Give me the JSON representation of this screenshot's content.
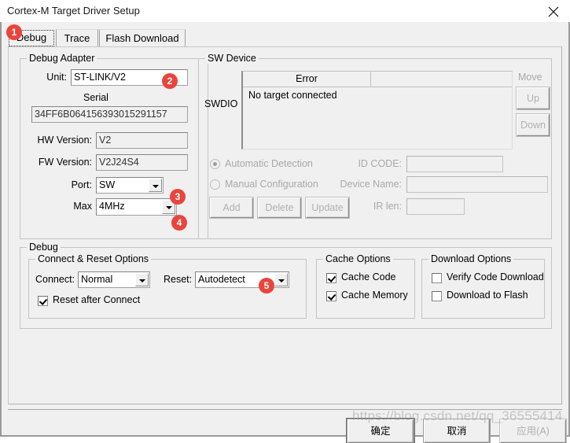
{
  "window": {
    "title": "Cortex-M Target Driver Setup",
    "close_icon": "close-icon"
  },
  "tabs": [
    {
      "label": "Debug",
      "selected": true
    },
    {
      "label": "Trace",
      "selected": false
    },
    {
      "label": "Flash Download",
      "selected": false
    }
  ],
  "debug_adapter": {
    "group_title": "Debug Adapter",
    "unit_label": "Unit:",
    "unit_value": "ST-LINK/V2",
    "serial_label": "Serial",
    "serial_value": "34FF6B064156393015291157",
    "hw_version_label": "HW Version:",
    "hw_version_value": "V2",
    "fw_version_label": "FW Version:",
    "fw_version_value": "V2J24S4",
    "port_label": "Port:",
    "port_value": "SW",
    "max_label": "Max",
    "max_value": "4MHz"
  },
  "sw_device": {
    "group_title": "SW Device",
    "swdio_label": "SWDIO",
    "columns": [
      "Error",
      ""
    ],
    "rows": [
      [
        "No target connected",
        ""
      ]
    ],
    "move_label": "Move",
    "up_label": "Up",
    "down_label": "Down",
    "automatic_detection_label": "Automatic Detection",
    "manual_configuration_label": "Manual Configuration",
    "id_code_label": "ID CODE:",
    "id_code_value": "",
    "device_name_label": "Device Name:",
    "device_name_value": "",
    "ir_len_label": "IR len:",
    "ir_len_value": "",
    "add_label": "Add",
    "delete_label": "Delete",
    "update_label": "Update"
  },
  "debug_section": {
    "group_title": "Debug",
    "connect_reset": {
      "group_title": "Connect & Reset Options",
      "connect_label": "Connect:",
      "connect_value": "Normal",
      "reset_label": "Reset:",
      "reset_value": "Autodetect",
      "reset_after_connect_label": "Reset after Connect",
      "reset_after_connect_checked": true
    },
    "cache_options": {
      "group_title": "Cache Options",
      "cache_code_label": "Cache Code",
      "cache_code_checked": true,
      "cache_memory_label": "Cache Memory",
      "cache_memory_checked": true
    },
    "download_options": {
      "group_title": "Download Options",
      "verify_code_download_label": "Verify Code Download",
      "verify_code_download_checked": false,
      "download_to_flash_label": "Download to Flash",
      "download_to_flash_checked": false
    }
  },
  "footer": {
    "ok_label": "确定",
    "cancel_label": "取消",
    "apply_label": "应用(A)"
  },
  "annotations": [
    {
      "number": "1"
    },
    {
      "number": "2"
    },
    {
      "number": "3"
    },
    {
      "number": "4"
    },
    {
      "number": "5"
    }
  ],
  "watermark": {
    "text": "https://blog.csdn.net/qq_36555414"
  },
  "colors": {
    "badge": "#e8453c",
    "dialog_bg": "#f0f0f0"
  }
}
